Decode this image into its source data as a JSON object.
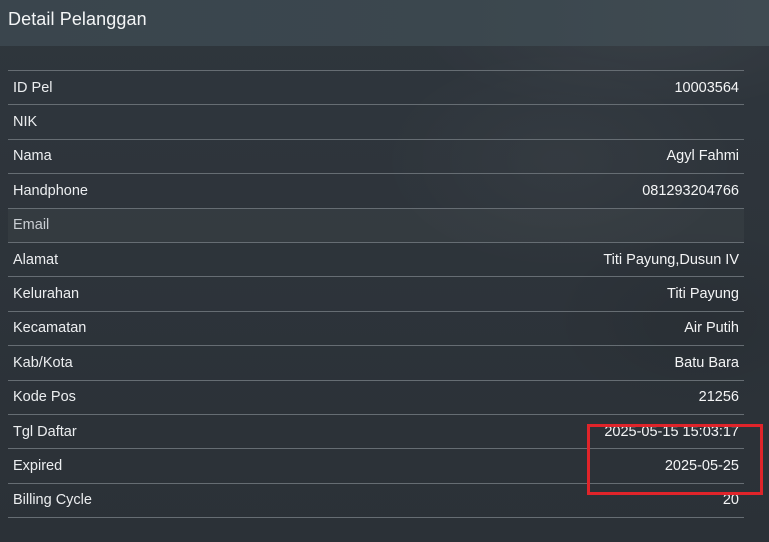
{
  "header": {
    "title": "Detail Pelanggan"
  },
  "rows": [
    {
      "label": "ID Pel",
      "value": "10003564"
    },
    {
      "label": "NIK",
      "value": ""
    },
    {
      "label": "Nama",
      "value": "Agyl Fahmi"
    },
    {
      "label": "Handphone",
      "value": "081293204766"
    },
    {
      "label": "Email",
      "value": ""
    },
    {
      "label": "Alamat",
      "value": "Titi Payung,Dusun IV"
    },
    {
      "label": "Kelurahan",
      "value": "Titi Payung"
    },
    {
      "label": "Kecamatan",
      "value": "Air Putih"
    },
    {
      "label": "Kab/Kota",
      "value": "Batu Bara"
    },
    {
      "label": "Kode Pos",
      "value": "21256"
    },
    {
      "label": "Tgl Daftar",
      "value": "2025-05-15 15:03:17"
    },
    {
      "label": "Expired",
      "value": "2025-05-25"
    },
    {
      "label": "Billing Cycle",
      "value": "20"
    }
  ],
  "annotation": {
    "highlight_color": "#e0242a"
  }
}
